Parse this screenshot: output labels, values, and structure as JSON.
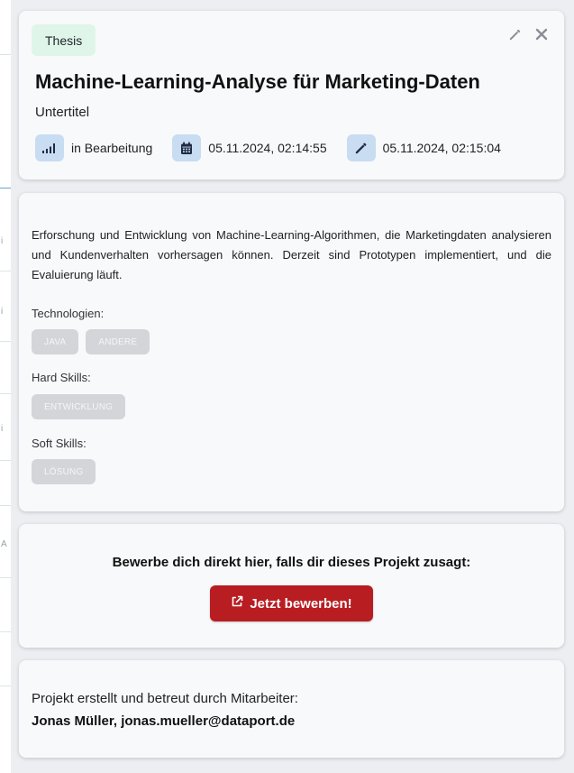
{
  "project": {
    "type_badge": "Thesis",
    "title": "Machine-Learning-Analyse für Marketing-Daten",
    "subtitle": "Untertitel",
    "status": "in Bearbeitung",
    "created": "05.11.2024, 02:14:55",
    "updated": "05.11.2024, 02:15:04",
    "description": "Erforschung und Entwicklung von Machine-Learning-Algorithmen, die Marketingdaten analysieren und Kundenverhalten vorhersagen können. Derzeit sind Prototypen implementiert, und die Evaluierung läuft."
  },
  "skills": {
    "technologies_label": "Technologien:",
    "technologies": [
      "JAVA",
      "ANDERE"
    ],
    "hard_skills_label": "Hard Skills:",
    "hard_skills": [
      "ENTWICKLUNG"
    ],
    "soft_skills_label": "Soft Skills:",
    "soft_skills": [
      "LÖSUNG"
    ]
  },
  "apply": {
    "prompt": "Bewerbe dich direkt hier, falls dir dieses Projekt zusagt:",
    "button_label": "Jetzt bewerben!"
  },
  "contact": {
    "line": "Projekt erstellt und betreut durch Mitarbeiter:",
    "person": "Jonas Müller, jonas.mueller@dataport.de"
  },
  "icons": {
    "edit": "pencil-icon",
    "close": "close-icon",
    "status": "signal-bars-icon",
    "created": "calendar-icon",
    "updated": "pencil-icon",
    "apply": "external-link-icon"
  },
  "colors": {
    "badge_bg": "#dff5ea",
    "meta_icon_bg": "#c8dcf2",
    "meta_icon_fg": "#1f2a44",
    "chip_bg": "#d3d5d9",
    "apply_button": "#b81d22"
  }
}
